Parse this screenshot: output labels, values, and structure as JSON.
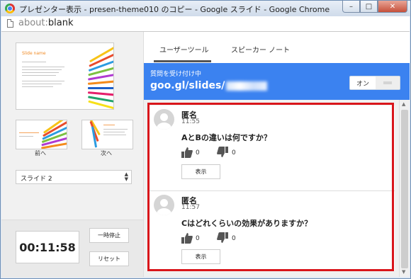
{
  "window": {
    "title": "プレゼンター表示 - presen-theme010 のコピー - Google スライド - Google Chrome",
    "address_prefix": "about:",
    "address_rest": "blank",
    "minimize": "–",
    "maximize": "□",
    "close": "✕"
  },
  "left": {
    "slide_title": "Slide name",
    "prev_label": "前へ",
    "next_label": "次へ",
    "slide_select": {
      "value": "スライド 2",
      "arrows": "▲▼"
    },
    "timer": "00:11:58",
    "pause_label": "一時停止",
    "reset_label": "リセット"
  },
  "right": {
    "tabs": [
      {
        "label": "ユーザーツール"
      },
      {
        "label": "スピーカー ノート"
      }
    ],
    "banner": {
      "subtitle": "質問を受け付け中",
      "url": "goo.gl/slides/",
      "on_label": "オン"
    },
    "questions": [
      {
        "name": "匿名",
        "time": "11:55",
        "text": "AとBの違いは何ですか？",
        "up": "0",
        "down": "0",
        "show_label": "表示"
      },
      {
        "name": "匿名",
        "time": "11:57",
        "text": "Cはどれくらいの効果がありますか？",
        "up": "0",
        "down": "0",
        "show_label": "表示"
      }
    ]
  },
  "colors": {
    "banner_blue": "#3b82f0",
    "highlight_red": "#d9151b",
    "accent_orange": "#f08a24"
  }
}
